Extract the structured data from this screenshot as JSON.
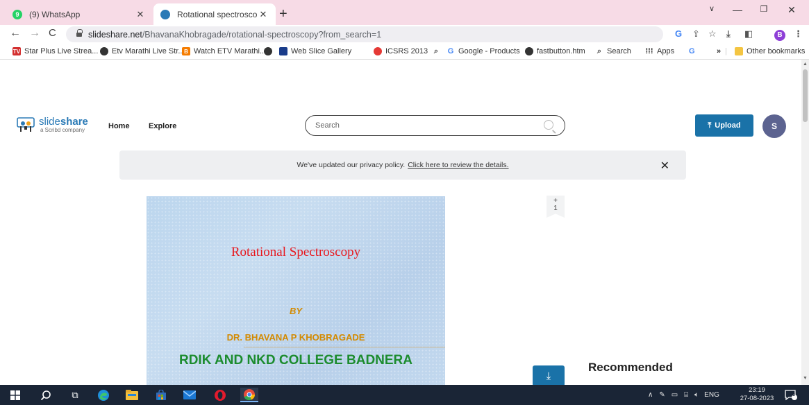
{
  "browser": {
    "tabs": [
      {
        "title": "(9) WhatsApp",
        "favicon_color": "#25d366",
        "favicon": "whatsapp-icon"
      },
      {
        "title": "Rotational spectroscopy | PPT",
        "favicon_color": "#2a7ab6",
        "favicon": "slideshare-icon"
      }
    ],
    "url_host": "slideshare.net",
    "url_path": "/BhavanaKhobragade/rotational-spectroscopy?from_search=1",
    "profile_letter": "B",
    "bookmarks": [
      {
        "label": "Star Plus Live Strea...",
        "icon_color": "#d32f2f",
        "icon_text": "TV"
      },
      {
        "label": "Etv Marathi Live Str...",
        "icon_color": "#333333",
        "icon_text": ""
      },
      {
        "label": "Watch ETV Marathi...",
        "icon_color": "#f57c00",
        "icon_text": "B"
      },
      {
        "label": "",
        "icon_color": "#333333",
        "icon_text": ""
      },
      {
        "label": "Web Slice Gallery",
        "icon_color": "#1a3c8a",
        "icon_text": ""
      },
      {
        "label": "ICSRS 2013",
        "icon_color": "#e53935",
        "icon_text": ""
      },
      {
        "label": "",
        "icon_color": "#555555",
        "icon_text": ""
      },
      {
        "label": "Google - Products",
        "icon_color": "#4285f4",
        "icon_text": "G"
      },
      {
        "label": "fastbutton.htm",
        "icon_color": "#333333",
        "icon_text": ""
      },
      {
        "label": "Search",
        "icon_color": "#555555",
        "icon_text": ""
      },
      {
        "label": "Apps",
        "icon_color": "#333333",
        "icon_text": ""
      }
    ],
    "bookmarks_overflow": "»",
    "other_bookmarks": "Other bookmarks"
  },
  "site": {
    "logo_word_light": "slide",
    "logo_word_bold": "share",
    "logo_sub": "a Scribd company",
    "nav": [
      "Home",
      "Explore"
    ],
    "search_placeholder": "Search",
    "upload_label": "Upload",
    "avatar_letter": "S",
    "notice_text": "We've updated our privacy policy.",
    "notice_link": "Click here to review the details.",
    "slide": {
      "title": "Rotational Spectroscopy",
      "by": "BY",
      "author": "DR.  BHAVANA P KHOBRAGADE",
      "college": "RDIK AND NKD COLLEGE BADNERA"
    },
    "page_marker_plus": "+",
    "page_marker_num": "1",
    "recommended": "Recommended"
  },
  "taskbar": {
    "lang": "ENG",
    "time": "23:19",
    "date": "27-08-2023",
    "notifications": "3"
  }
}
